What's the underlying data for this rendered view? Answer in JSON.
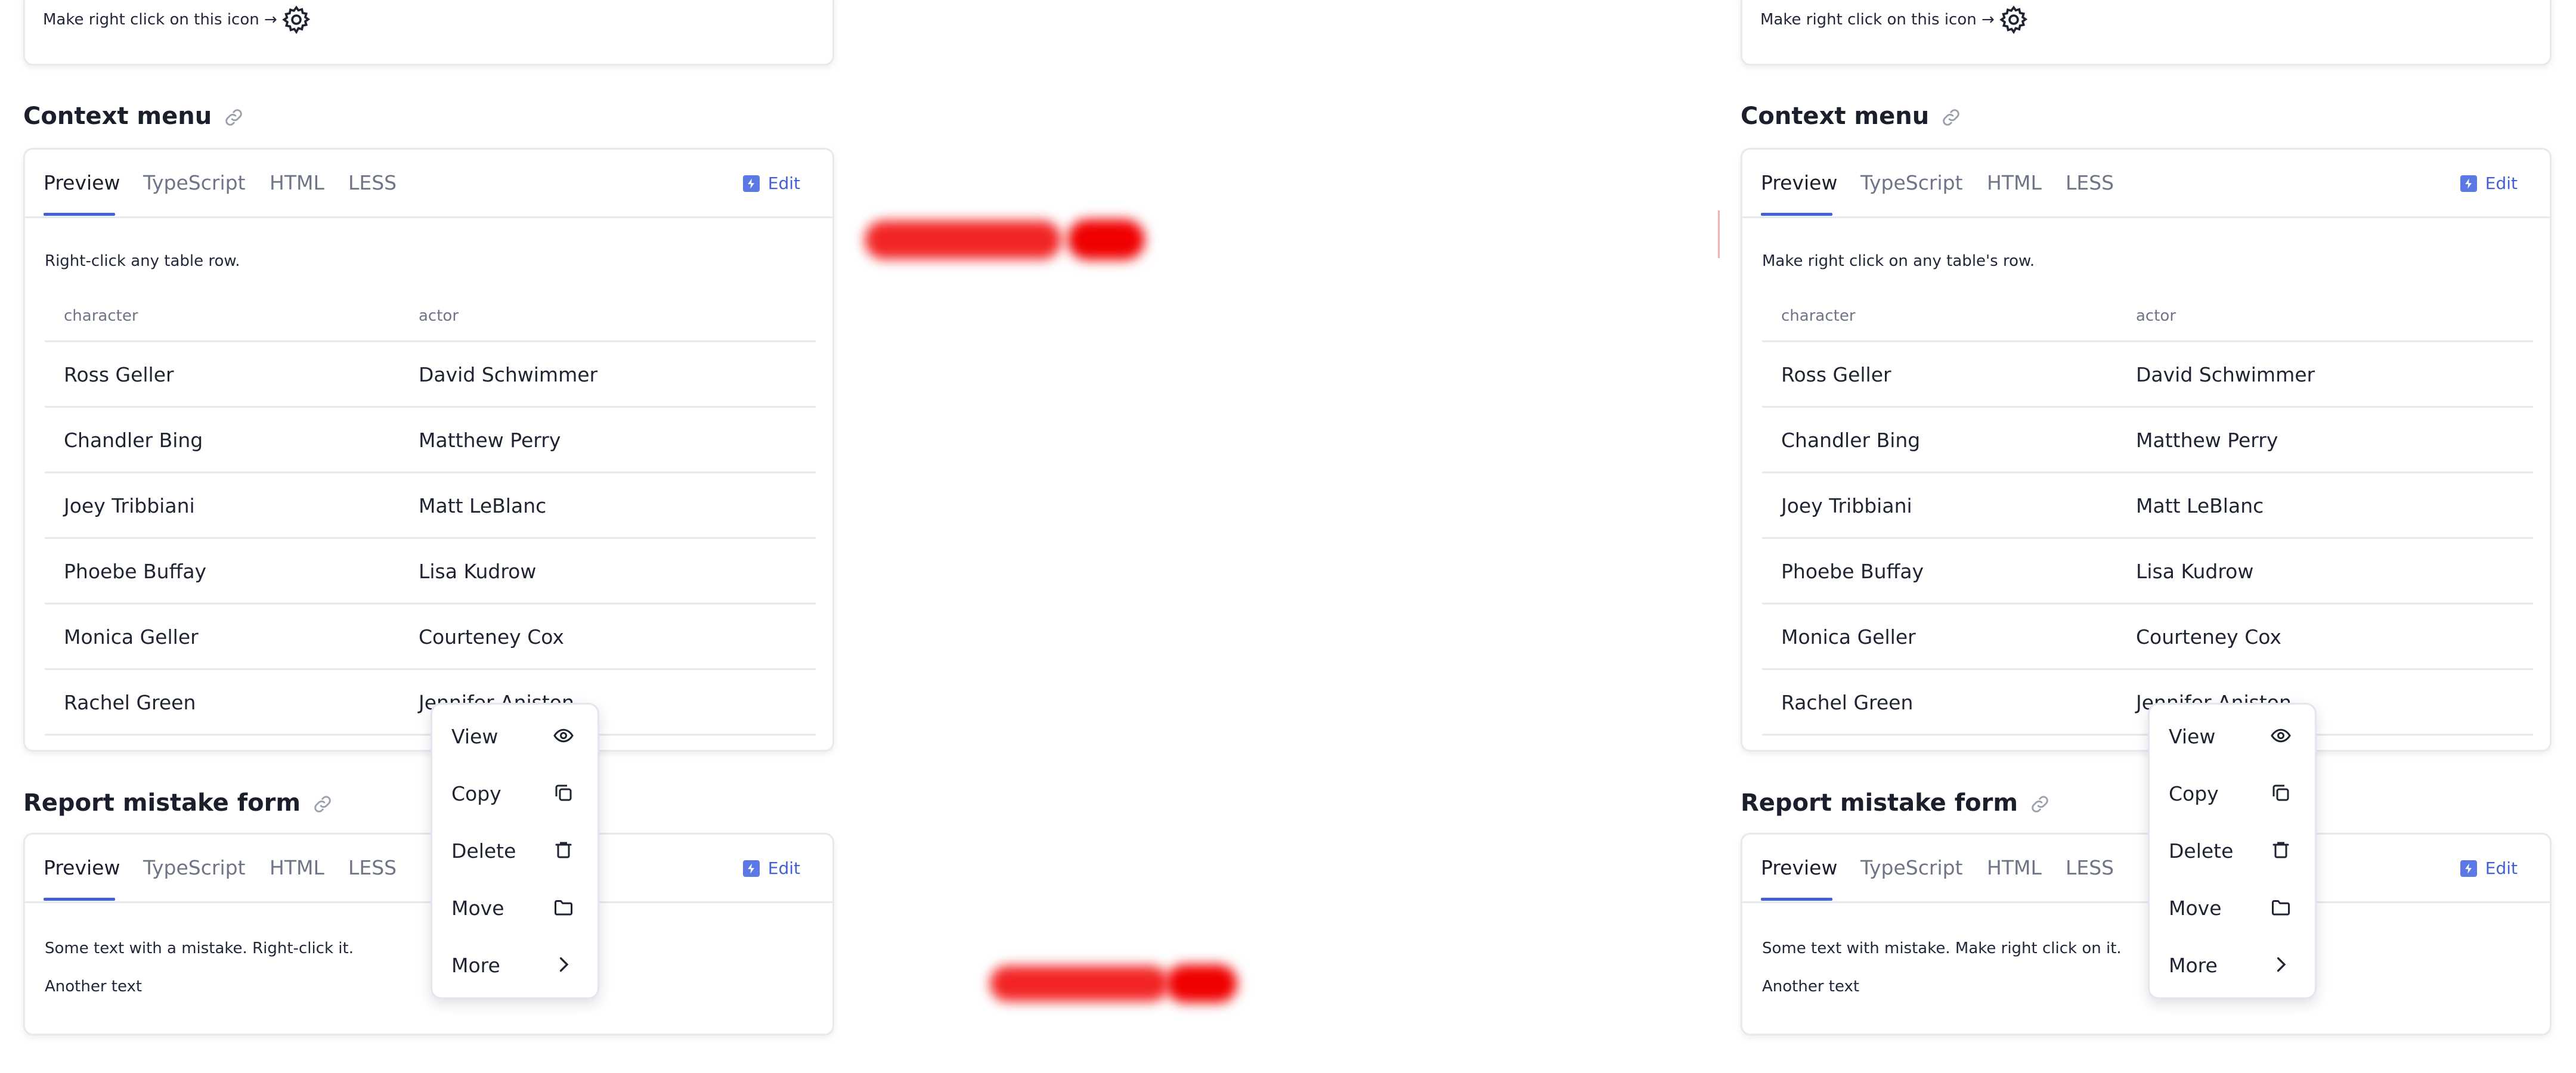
{
  "panes": {
    "left": {
      "top_card": {
        "text": "Make right click on this icon →",
        "icon": "gear-icon"
      },
      "context_section": {
        "title": "Context menu",
        "tabs": [
          "Preview",
          "TypeScript",
          "HTML",
          "LESS"
        ],
        "active_tab": "Preview",
        "edit_label": "Edit",
        "intro": "Right-click any table row.",
        "table": {
          "columns": [
            "character",
            "actor"
          ],
          "rows": [
            [
              "Ross Geller",
              "David Schwimmer"
            ],
            [
              "Chandler Bing",
              "Matthew Perry"
            ],
            [
              "Joey Tribbiani",
              "Matt LeBlanc"
            ],
            [
              "Phoebe Buffay",
              "Lisa Kudrow"
            ],
            [
              "Monica Geller",
              "Courteney Cox"
            ],
            [
              "Rachel Green",
              "Jennifer Aniston"
            ]
          ]
        }
      },
      "report_section": {
        "title": "Report mistake form",
        "tabs": [
          "Preview",
          "TypeScript",
          "HTML",
          "LESS"
        ],
        "active_tab": "Preview",
        "edit_label": "Edit",
        "line1": "Some text with a mistake. Right-click it.",
        "line2": "Another text"
      },
      "context_menu": {
        "items": [
          {
            "label": "View",
            "icon": "eye-icon"
          },
          {
            "label": "Copy",
            "icon": "copy-icon"
          },
          {
            "label": "Delete",
            "icon": "trash-icon"
          },
          {
            "label": "Move",
            "icon": "folder-icon"
          },
          {
            "label": "More",
            "icon": "chevron-right-icon"
          }
        ]
      }
    },
    "right": {
      "top_card": {
        "text": "Make right click on this icon →",
        "icon": "gear-icon"
      },
      "context_section": {
        "title": "Context menu",
        "tabs": [
          "Preview",
          "TypeScript",
          "HTML",
          "LESS"
        ],
        "active_tab": "Preview",
        "edit_label": "Edit",
        "intro": "Make right click on any table's row.",
        "table": {
          "columns": [
            "character",
            "actor"
          ],
          "rows": [
            [
              "Ross Geller",
              "David Schwimmer"
            ],
            [
              "Chandler Bing",
              "Matthew Perry"
            ],
            [
              "Joey Tribbiani",
              "Matt LeBlanc"
            ],
            [
              "Phoebe Buffay",
              "Lisa Kudrow"
            ],
            [
              "Monica Geller",
              "Courteney Cox"
            ],
            [
              "Rachel Green",
              "Jennifer Aniston"
            ]
          ]
        }
      },
      "report_section": {
        "title": "Report mistake form",
        "tabs": [
          "Preview",
          "TypeScript",
          "HTML",
          "LESS"
        ],
        "active_tab": "Preview",
        "edit_label": "Edit",
        "line1": "Some text with mistake. Make right click on it.",
        "line2": "Another text"
      },
      "context_menu": {
        "items": [
          {
            "label": "View",
            "icon": "eye-icon"
          },
          {
            "label": "Copy",
            "icon": "copy-icon"
          },
          {
            "label": "Delete",
            "icon": "trash-icon"
          },
          {
            "label": "Move",
            "icon": "folder-icon"
          },
          {
            "label": "More",
            "icon": "chevron-right-icon"
          }
        ]
      }
    }
  },
  "colors": {
    "accent": "#4460d8",
    "diff_mark": "#f00000",
    "border": "#e7e9ef"
  }
}
